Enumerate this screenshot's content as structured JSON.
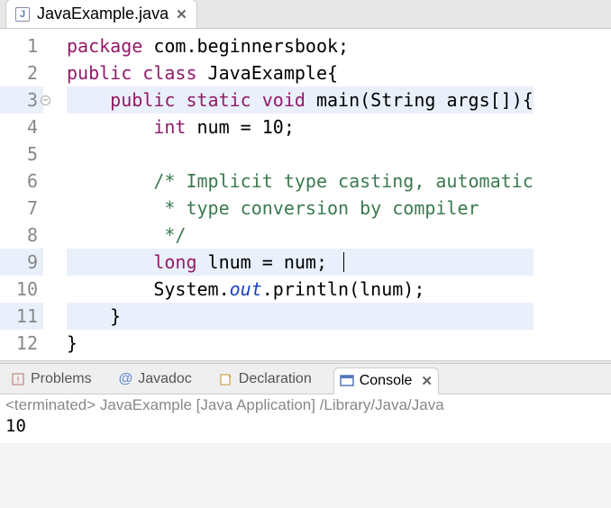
{
  "editor": {
    "tab": {
      "filename": "JavaExample.java"
    },
    "lines": [
      {
        "n": 1,
        "tokens": [
          [
            "kw",
            "package"
          ],
          [
            "",
            " com.beginnersbook;"
          ]
        ]
      },
      {
        "n": 2,
        "tokens": [
          [
            "kw",
            "public"
          ],
          [
            "",
            " "
          ],
          [
            "kw",
            "class"
          ],
          [
            "",
            " JavaExample{"
          ]
        ]
      },
      {
        "n": 3,
        "fold": true,
        "hl": true,
        "tokens": [
          [
            "",
            "    "
          ],
          [
            "kw",
            "public"
          ],
          [
            "",
            " "
          ],
          [
            "kw",
            "static"
          ],
          [
            "",
            " "
          ],
          [
            "kw",
            "void"
          ],
          [
            "",
            " main(String args[]){"
          ]
        ]
      },
      {
        "n": 4,
        "tokens": [
          [
            "",
            "        "
          ],
          [
            "kw",
            "int"
          ],
          [
            "",
            " num = 10;"
          ]
        ]
      },
      {
        "n": 5,
        "tokens": [
          [
            "",
            ""
          ]
        ]
      },
      {
        "n": 6,
        "tokens": [
          [
            "",
            "        "
          ],
          [
            "comment",
            "/* Implicit type casting, automatic"
          ]
        ]
      },
      {
        "n": 7,
        "tokens": [
          [
            "",
            "        "
          ],
          [
            "comment",
            " * type conversion by compiler"
          ]
        ]
      },
      {
        "n": 8,
        "tokens": [
          [
            "",
            "        "
          ],
          [
            "comment",
            " */"
          ]
        ]
      },
      {
        "n": 9,
        "hl": true,
        "caret": true,
        "tokens": [
          [
            "",
            "        "
          ],
          [
            "kw",
            "long"
          ],
          [
            "",
            " lnum = num; "
          ]
        ]
      },
      {
        "n": 10,
        "tokens": [
          [
            "",
            "        System."
          ],
          [
            "field",
            "out"
          ],
          [
            "",
            ".println(lnum);"
          ]
        ]
      },
      {
        "n": 11,
        "hl": true,
        "tokens": [
          [
            "",
            "    }"
          ]
        ]
      },
      {
        "n": 12,
        "tokens": [
          [
            "",
            "}"
          ]
        ]
      }
    ]
  },
  "views": {
    "problems": "Problems",
    "javadoc": "Javadoc",
    "declaration": "Declaration",
    "console": "Console"
  },
  "console": {
    "status": "<terminated> JavaExample [Java Application] /Library/Java/Java",
    "output": "10"
  }
}
